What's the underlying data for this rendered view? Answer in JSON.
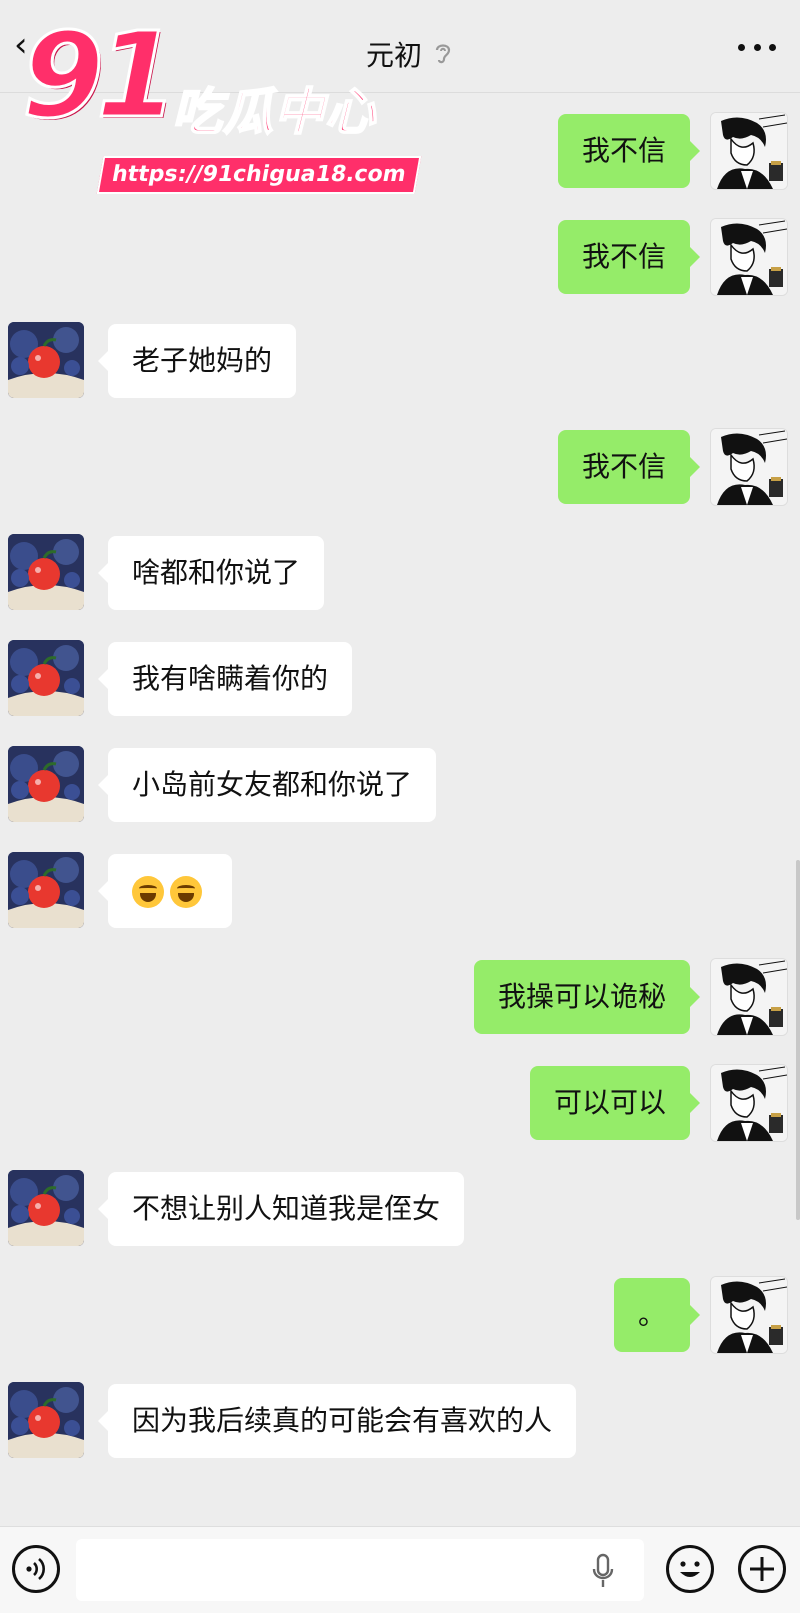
{
  "header": {
    "title": "元初",
    "back_icon": "chevron-left-icon",
    "ear_icon": "ear-icon",
    "more_icon": "more-icon"
  },
  "watermark": {
    "number": "91",
    "name": "吃瓜中心",
    "url": "https://91chigua18.com"
  },
  "messages": [
    {
      "side": "right",
      "text": "我不信"
    },
    {
      "side": "right",
      "text": "我不信"
    },
    {
      "side": "left",
      "text": "老子她妈的"
    },
    {
      "side": "right",
      "text": "我不信"
    },
    {
      "side": "left",
      "text": "啥都和你说了"
    },
    {
      "side": "left",
      "text": "我有啥瞒着你的"
    },
    {
      "side": "left",
      "text": "小岛前女友都和你说了"
    },
    {
      "side": "left",
      "text": "",
      "emoji": "joy-emoji",
      "emoji_count": 2
    },
    {
      "side": "right",
      "text": "我操可以诡秘"
    },
    {
      "side": "right",
      "text": "可以可以"
    },
    {
      "side": "left",
      "text": "不想让别人知道我是侄女"
    },
    {
      "side": "right",
      "text": "。"
    },
    {
      "side": "left",
      "text": "因为我后续真的可能会有喜欢的人"
    }
  ],
  "input_bar": {
    "voice_icon": "voice-icon",
    "input_value": "",
    "mic_icon": "mic-icon",
    "emoji_icon": "smile-icon",
    "plus_icon": "plus-icon"
  },
  "colors": {
    "background": "#ededed",
    "sent_bubble": "#95ec69",
    "received_bubble": "#ffffff",
    "watermark": "#ff2f6a"
  }
}
